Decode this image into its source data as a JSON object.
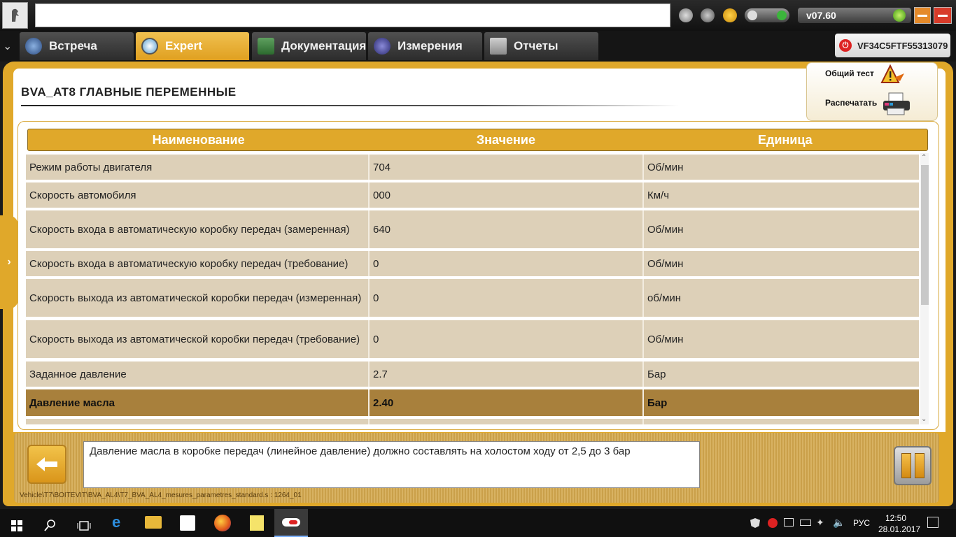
{
  "app": {
    "version": "v07.60",
    "vin": "VF34C5FTF55313079"
  },
  "tabs": [
    {
      "label": "Встреча"
    },
    {
      "label": "Expert"
    },
    {
      "label": "Документация"
    },
    {
      "label": "Измерения"
    },
    {
      "label": "Отчеты"
    }
  ],
  "page": {
    "title": "BVA_AT8  ГЛАВНЫЕ ПЕРЕМЕННЫЕ"
  },
  "actions": {
    "general_test": "Общий тест",
    "print": "Распечатать"
  },
  "table": {
    "headers": [
      "Наименование",
      "Значение",
      "Единица"
    ],
    "rows": [
      {
        "name": "Режим работы двигателя",
        "value": "704",
        "unit": "Об/мин"
      },
      {
        "name": "Скорость автомобиля",
        "value": "000",
        "unit": "Км/ч"
      },
      {
        "name": "Скорость входа в автоматическую коробку передач (замеренная)",
        "value": "640",
        "unit": "Об/мин"
      },
      {
        "name": "Скорость входа в автоматическую коробку передач (требование)",
        "value": "0",
        "unit": "Об/мин"
      },
      {
        "name": "Скорость выхода из автоматической коробки передач (измеренная)",
        "value": "0",
        "unit": "об/мин"
      },
      {
        "name": "Скорость выхода из автоматической коробки передач (требование)",
        "value": "0",
        "unit": "Об/мин"
      },
      {
        "name": "Заданное давление",
        "value": "2.7",
        "unit": "Бар"
      },
      {
        "name": "Давление масла",
        "value": "2.40",
        "unit": "Бар"
      }
    ]
  },
  "info": {
    "message": "Давление масла в коробке передач (линейное давление) должно составлять на холостом ходу от 2,5 до 3 бар",
    "path": "Vehicle\\T7\\BOITEVIT\\BVA_AL4\\T7_BVA_AL4_mesures_parametres_standard.s : 1264_01"
  },
  "taskbar": {
    "language": "РУС",
    "time": "12:50",
    "date": "28.01.2017"
  },
  "colors": {
    "accent": "#e0a82a",
    "row_bg": "#ddd0b8",
    "row_selected": "#a8803c"
  }
}
